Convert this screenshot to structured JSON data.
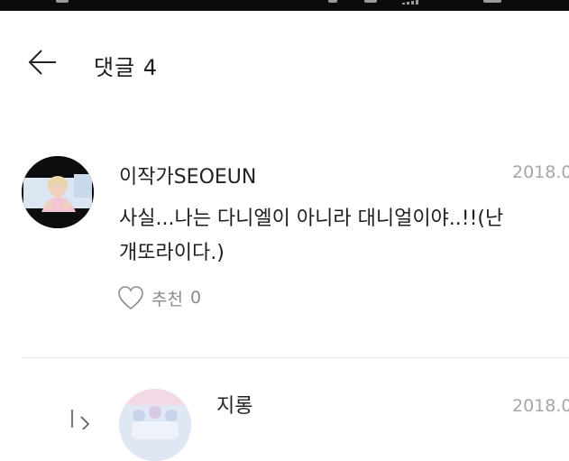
{
  "header": {
    "title": "댓글 4"
  },
  "comments": [
    {
      "author": "이작가SEOEUN",
      "date": "2018.0",
      "text": "사실...나는 다니엘이 아니라 대니얼이야..!!(난 개또라이다.)",
      "like_label": "추천",
      "like_count": "0"
    },
    {
      "author": "지롱",
      "date": "2018.0"
    }
  ],
  "colors": {
    "date": "#a6a6a6",
    "like": "#8c8c8c",
    "divider": "#e3e3e3"
  }
}
